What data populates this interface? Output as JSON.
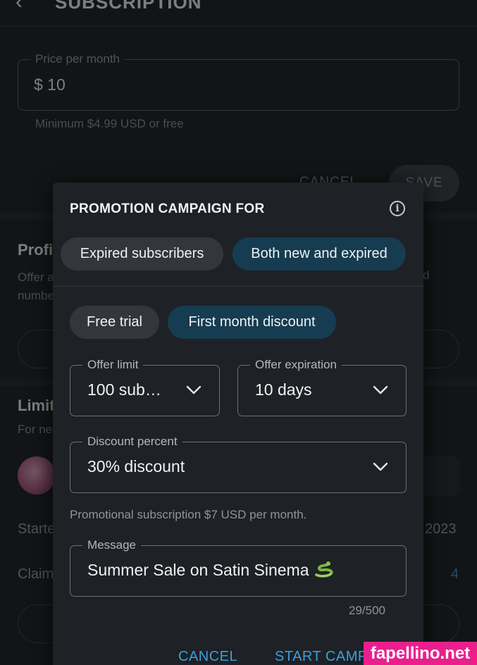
{
  "background": {
    "page_title": "SUBSCRIPTION",
    "price_field": {
      "label": "Price per month",
      "value": "$ 10"
    },
    "price_hint": "Minimum $4.99 USD or free",
    "cancel_label": "CANCEL",
    "save_label": "SAVE",
    "section_profile_heading": "Profi",
    "section_profile_text": "Offer a",
    "section_profile_text_line2": "numbe",
    "section_profile_text_right": "d",
    "section_limited_heading": "Limit",
    "section_limited_text": "For ne",
    "started_label": "Starte",
    "started_year": "2023",
    "claimed_label": "Claim",
    "claimed_count": "4"
  },
  "modal": {
    "title": "PROMOTION CAMPAIGN FOR",
    "audience_options": [
      {
        "label": "Expired subscribers",
        "selected": false
      },
      {
        "label": "Both new and expired",
        "selected": true
      }
    ],
    "offer_types": [
      {
        "label": "Free trial",
        "selected": false
      },
      {
        "label": "First month discount",
        "selected": true
      }
    ],
    "offer_limit": {
      "label": "Offer limit",
      "value": "100 sub…"
    },
    "offer_expiration": {
      "label": "Offer expiration",
      "value": "10 days"
    },
    "discount_percent": {
      "label": "Discount percent",
      "value": "30% discount"
    },
    "promo_hint": "Promotional subscription $7 USD per month.",
    "message": {
      "label": "Message",
      "value": "Summer Sale on Satin Sinema"
    },
    "message_counter": "29/500",
    "cancel_label": "CANCEL",
    "start_label": "START CAMP"
  },
  "watermark": "fapellino.net",
  "colors": {
    "accent": "#3a9fe0",
    "selected_chip": "#163c51",
    "modal_bg": "#1e2125",
    "watermark_bg": "#ea1f8d"
  },
  "icons": [
    "back-arrow-icon",
    "info-icon",
    "chevron-down-icon",
    "snake-emoji-icon"
  ]
}
